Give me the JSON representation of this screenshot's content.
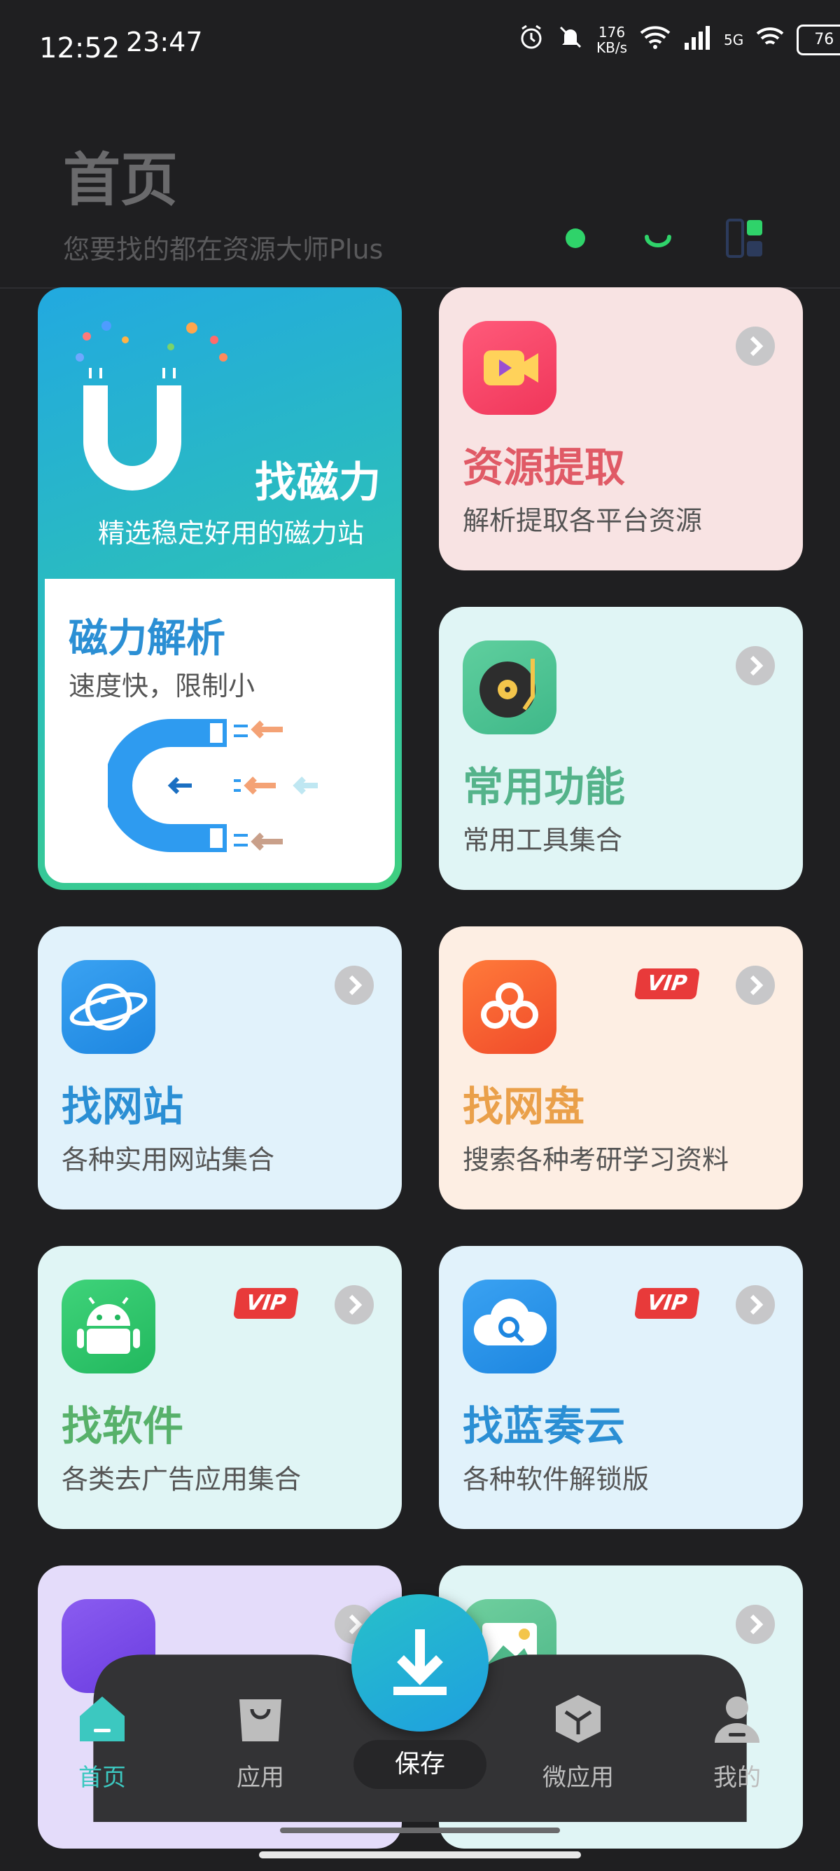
{
  "status_bar": {
    "time": "12:52",
    "secondary_time": "23:47",
    "net_speed_value": "176",
    "net_speed_unit": "KB/s",
    "network": "5G",
    "battery": "76"
  },
  "header": {
    "title": "首页",
    "subtitle": "您要找的都在资源大师Plus"
  },
  "magnet_card": {
    "title": "找磁力",
    "desc": "精选稳定好用的磁力站",
    "inner_title": "磁力解析",
    "inner_desc": "速度快，限制小"
  },
  "cards": [
    {
      "title": "资源提取",
      "desc": "解析提取各平台资源",
      "title_color": "#e05a66",
      "bg": "#f8e3e3",
      "icon": "video-icon",
      "vip": false
    },
    {
      "title": "常用功能",
      "desc": "常用工具集合",
      "title_color": "#54b38a",
      "bg": "#e0f5f5",
      "icon": "vinyl-icon",
      "vip": false
    },
    {
      "title": "找网站",
      "desc": "各种实用网站集合",
      "title_color": "#2b8fd4",
      "bg": "#e1f2fb",
      "icon": "planet-icon",
      "vip": false
    },
    {
      "title": "找网盘",
      "desc": "搜索各种考研学习资料",
      "title_color": "#eaa04a",
      "bg": "#fdeee3",
      "icon": "cloud-drive-icon",
      "vip": true
    },
    {
      "title": "找软件",
      "desc": "各类去广告应用集合",
      "title_color": "#57b16a",
      "bg": "#e0f5f5",
      "icon": "android-icon",
      "vip": true
    },
    {
      "title": "找蓝奏云",
      "desc": "各种软件解锁版",
      "title_color": "#2b8fd4",
      "bg": "#e1f2fb",
      "icon": "cloud-search-icon",
      "vip": true
    }
  ],
  "vip_label": "VIP",
  "nav": {
    "items": [
      {
        "label": "首页",
        "icon": "home-icon",
        "active": true
      },
      {
        "label": "应用",
        "icon": "bag-icon",
        "active": false
      },
      {
        "label": "微应用",
        "icon": "cube-icon",
        "active": false
      },
      {
        "label": "我的",
        "icon": "person-icon",
        "active": false
      }
    ],
    "save_label": "保存"
  }
}
